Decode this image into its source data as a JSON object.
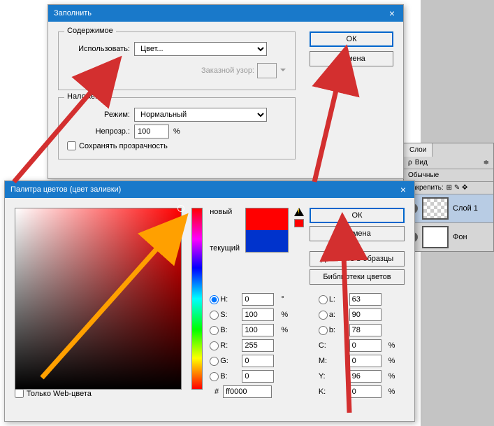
{
  "fill": {
    "title": "Заполнить",
    "ok": "ОК",
    "cancel": "Отмена",
    "content": {
      "legend": "Содержимое",
      "use_label": "Использовать:",
      "use_value": "Цвет...",
      "pattern_label": "Заказной узор:"
    },
    "blend": {
      "legend": "Наложение",
      "mode_label": "Режим:",
      "mode_value": "Нормальный",
      "opacity_label": "Непрозр.:",
      "opacity_value": "100",
      "opacity_unit": "%",
      "preserve": "Сохранять прозрачность"
    }
  },
  "picker": {
    "title": "Палитра цветов (цвет заливки)",
    "ok": "ОК",
    "cancel": "Отмена",
    "add": "Добавить в образцы",
    "libraries": "Библиотеки цветов",
    "new": "новый",
    "current": "текущий",
    "web_only": "Только Web-цвета",
    "hex_label": "#",
    "hex_value": "ff0000",
    "H": "0",
    "Hu": "°",
    "S": "100",
    "Su": "%",
    "Bv": "100",
    "Bvu": "%",
    "R": "255",
    "G": "0",
    "B": "0",
    "L": "63",
    "a": "90",
    "bb": "78",
    "C": "0",
    "Cu": "%",
    "M": "0",
    "Mu": "%",
    "Y": "96",
    "Yu": "%",
    "K": "0",
    "Ku": "%"
  },
  "layers": {
    "tab": "Слои",
    "kind": "Вид",
    "mode": "Обычные",
    "lock": "Закрепить:",
    "layer1": "Слой 1",
    "bg": "Фон"
  }
}
